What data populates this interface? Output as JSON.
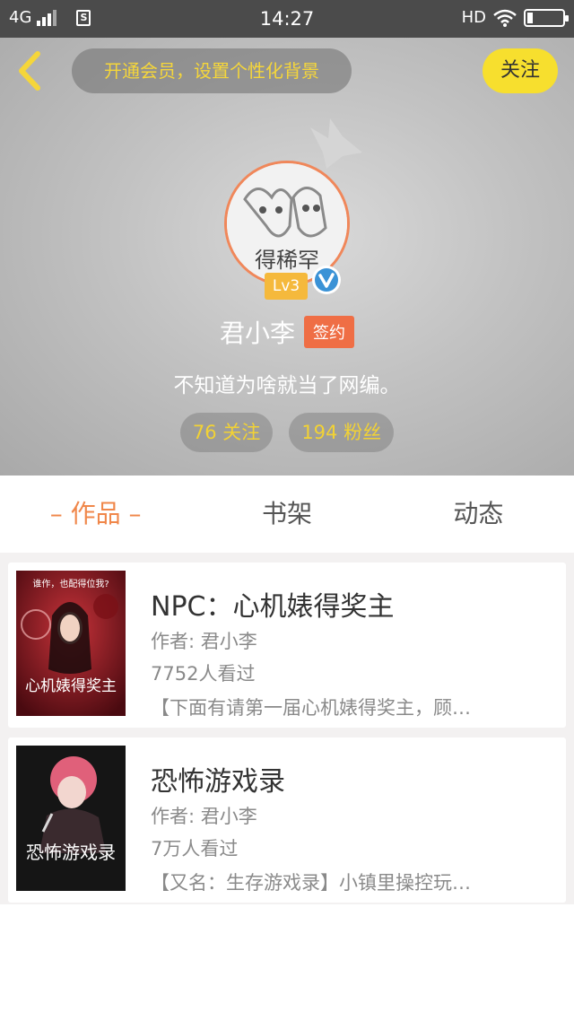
{
  "status_bar": {
    "network": "4G",
    "sim": "S",
    "time": "14:27",
    "hd": "HD",
    "battery_level": 0.12
  },
  "header": {
    "vip_banner": "开通会员，设置个性化背景",
    "follow_label": "关注",
    "level": "Lv3",
    "username": "君小李",
    "signed_badge": "签约",
    "bio": "不知道为啥就当了网编。",
    "following": "76 关注",
    "followers": "194 粉丝",
    "avatar_text": "得稀罕"
  },
  "tabs": [
    {
      "label": "– 作品 –",
      "active": true
    },
    {
      "label": "书架",
      "active": false
    },
    {
      "label": "动态",
      "active": false
    }
  ],
  "books": [
    {
      "title": "NPC：心机婊得奖主",
      "author": "作者: 君小李",
      "views": "7752人看过",
      "desc": "【下面有请第一届心机婊得奖主，顾…",
      "cover_top": "谁作，也配得位我?",
      "cover_title": "心机婊得奖主"
    },
    {
      "title": "恐怖游戏录",
      "author": "作者: 君小李",
      "views": "7万人看过",
      "desc": "【又名：生存游戏录】小镇里操控玩…",
      "cover_title": "恐怖游戏录"
    }
  ],
  "colors": {
    "accent_orange": "#f0874a",
    "follow_yellow": "#f7df2e",
    "stat_yellow": "#f2d234",
    "signed_red": "#ef6e45",
    "verified_blue": "#3a92d6"
  }
}
